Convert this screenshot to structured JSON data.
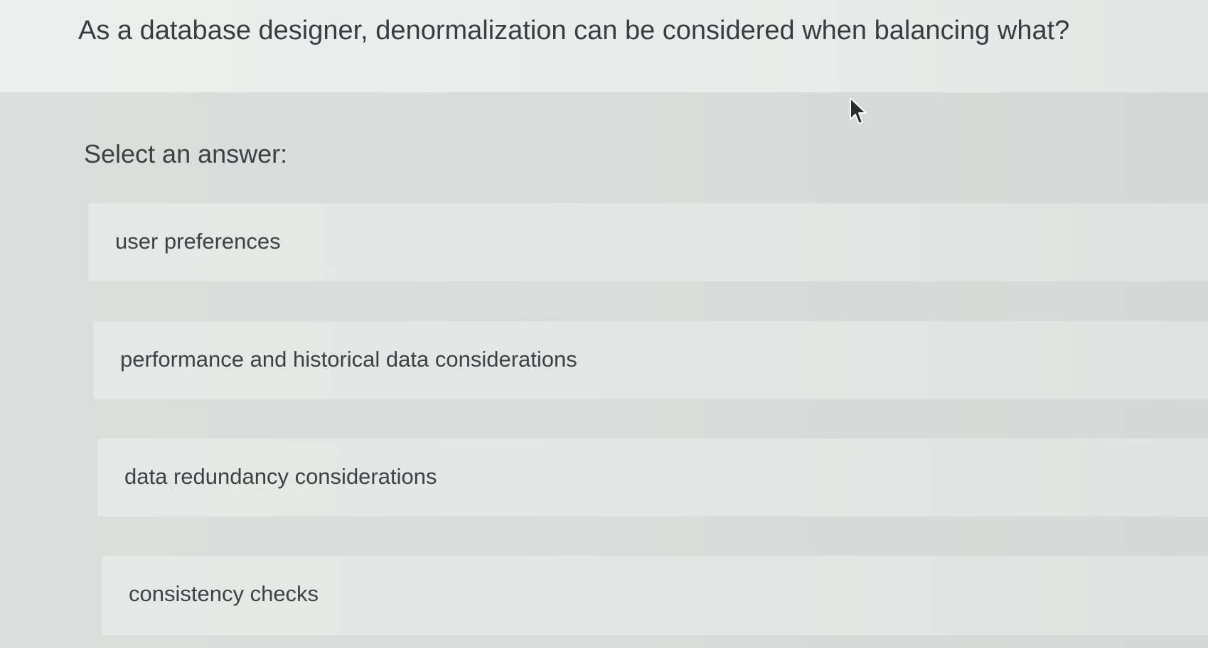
{
  "question": {
    "text": "As a database designer, denormalization can be considered when balancing what?"
  },
  "answer_section": {
    "prompt": "Select an answer:",
    "options": [
      {
        "label": "user preferences"
      },
      {
        "label": "performance and historical data considerations"
      },
      {
        "label": "data redundancy considerations"
      },
      {
        "label": "consistency checks"
      }
    ]
  },
  "cursor": {
    "icon": "mouse-pointer-icon"
  }
}
